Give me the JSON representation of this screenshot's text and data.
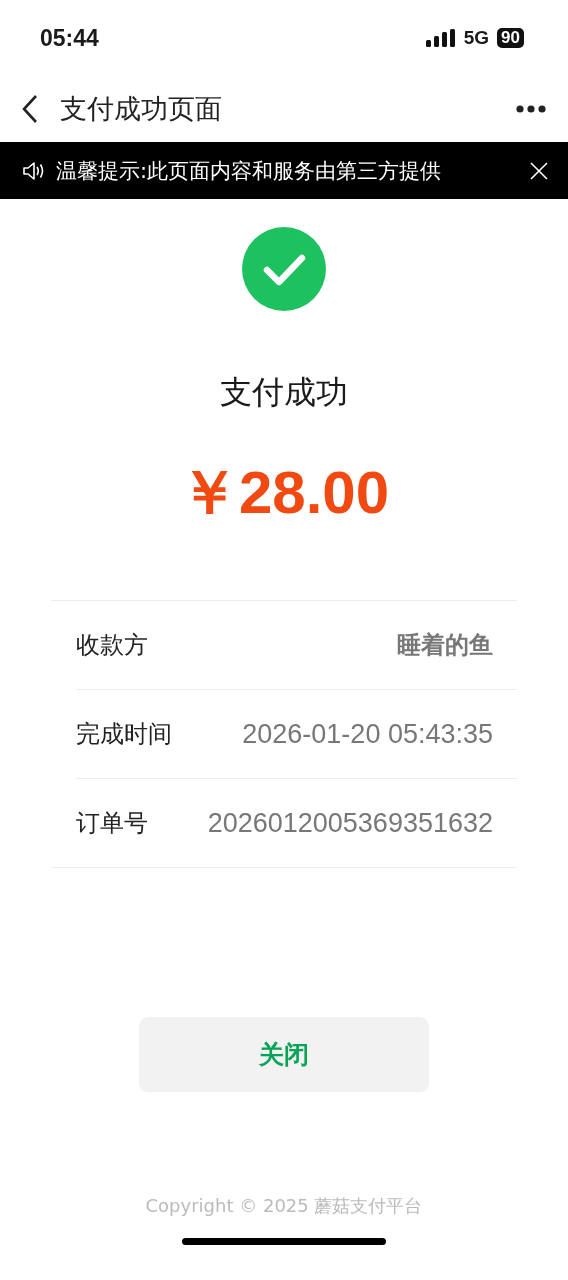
{
  "status_bar": {
    "time": "05:44",
    "network": "5G",
    "battery": "90"
  },
  "nav": {
    "title": "支付成功页面"
  },
  "notice": {
    "text": "温馨提示:此页面内容和服务由第三方提供"
  },
  "result": {
    "title": "支付成功",
    "amount": "￥28.00"
  },
  "details": [
    {
      "label": "收款方",
      "value": "睡着的鱼",
      "kind": "name"
    },
    {
      "label": "完成时间",
      "value": "2026-01-20 05:43:35",
      "kind": "text"
    },
    {
      "label": "订单号",
      "value": "2026012005369351632",
      "kind": "text"
    }
  ],
  "close_button": "关闭",
  "footer": "Copyright © 2025 蘑菇支付平台"
}
